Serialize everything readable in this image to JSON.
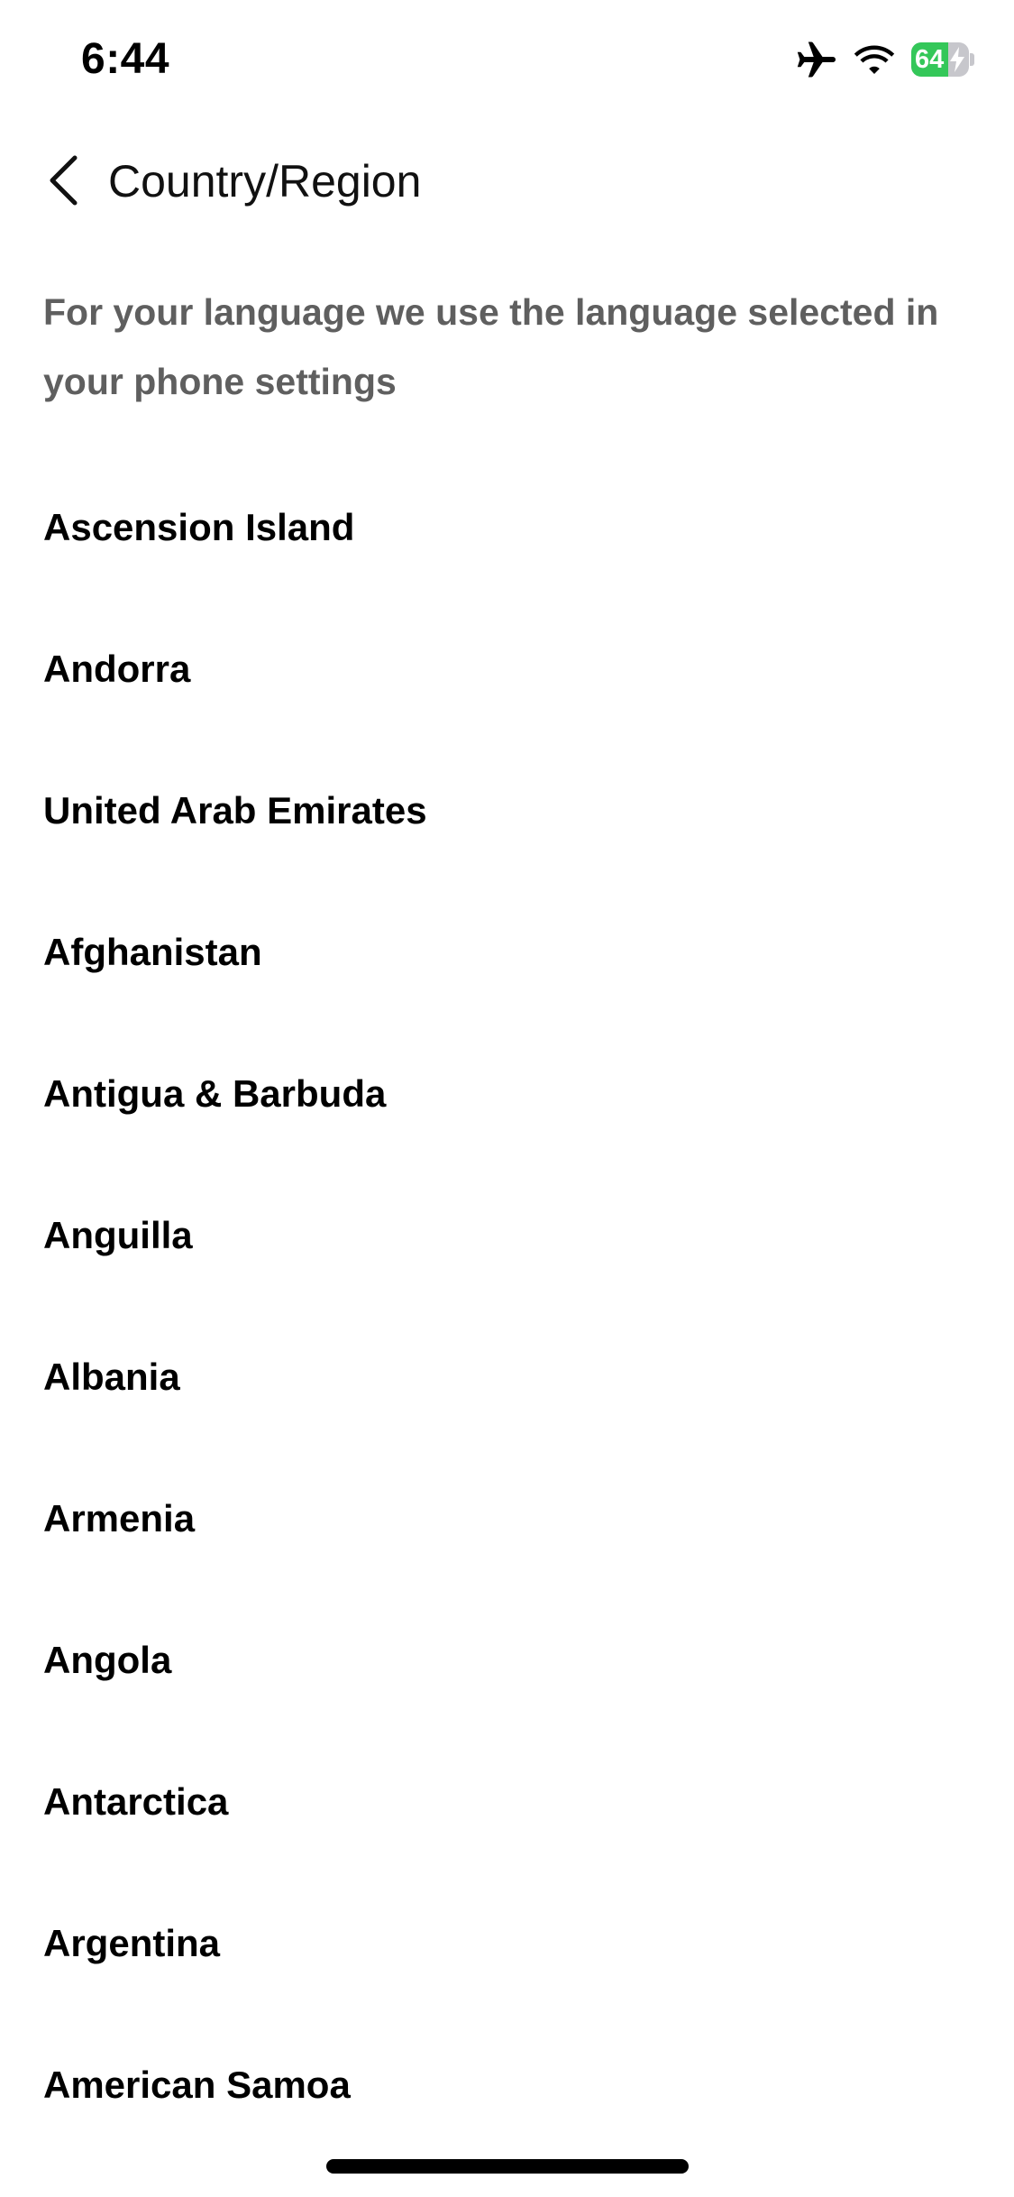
{
  "status_bar": {
    "time": "6:44",
    "battery_level": "64",
    "battery_fraction": 0.64,
    "airplane_mode": true,
    "charging": true,
    "icons": [
      "airplane-icon",
      "wifi-icon",
      "battery-icon",
      "charging-bolt-icon"
    ]
  },
  "nav": {
    "title": "Country/Region",
    "back_icon": "chevron-left-icon"
  },
  "description": "For your language we use the language selected in your phone settings",
  "countries": [
    "Ascension Island",
    "Andorra",
    "United Arab Emirates",
    "Afghanistan",
    "Antigua & Barbuda",
    "Anguilla",
    "Albania",
    "Armenia",
    "Angola",
    "Antarctica",
    "Argentina",
    "American Samoa"
  ],
  "colors": {
    "battery_green": "#34c759",
    "description_text": "#5f5f5f"
  }
}
